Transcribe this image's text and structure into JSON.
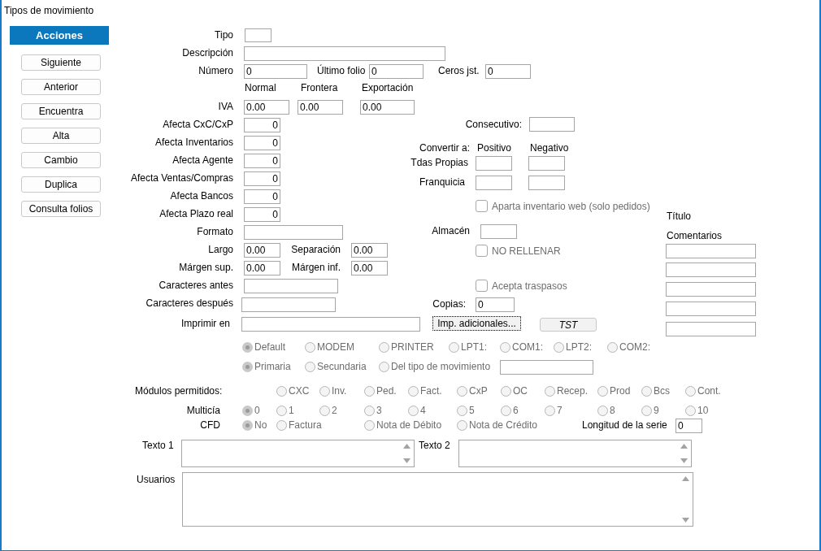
{
  "window": {
    "title": "Tipos de movimiento"
  },
  "sidebar": {
    "header": "Acciones",
    "buttons": [
      "Siguiente",
      "Anterior",
      "Encuentra",
      "Alta",
      "Cambio",
      "Duplica",
      "Consulta folios"
    ]
  },
  "form": {
    "items": [
      {
        "kind": "label",
        "text": "Tipo"
      },
      {
        "kind": "field"
      },
      {
        "kind": "label",
        "text": "Descripción"
      },
      {
        "kind": "field"
      },
      {
        "kind": "label",
        "text": "Número"
      },
      {
        "kind": "field",
        "value": "0"
      },
      {
        "kind": "label",
        "text": "Último folio"
      },
      {
        "kind": "field",
        "value": "0"
      },
      {
        "kind": "label",
        "text": "Ceros jst."
      },
      {
        "kind": "field",
        "value": "0"
      },
      {
        "kind": "label",
        "text": "Normal"
      },
      {
        "kind": "label",
        "text": "Frontera"
      },
      {
        "kind": "label",
        "text": "Exportación"
      },
      {
        "kind": "label",
        "text": "IVA"
      },
      {
        "kind": "field",
        "value": "0.00"
      },
      {
        "kind": "field",
        "value": "0.00"
      },
      {
        "kind": "field",
        "value": "0.00"
      },
      {
        "kind": "label",
        "text": "Afecta  CxC/CxP"
      },
      {
        "kind": "field",
        "value": "0"
      },
      {
        "kind": "label",
        "text": "Afecta  Inventarios"
      },
      {
        "kind": "field",
        "value": "0"
      },
      {
        "kind": "label",
        "text": "Afecta  Agente"
      },
      {
        "kind": "field",
        "value": "0"
      },
      {
        "kind": "label",
        "text": "Afecta  Ventas/Compras"
      },
      {
        "kind": "field",
        "value": "0"
      },
      {
        "kind": "label",
        "text": "Afecta  Bancos"
      },
      {
        "kind": "field",
        "value": "0"
      },
      {
        "kind": "label",
        "text": "Afecta  Plazo real"
      },
      {
        "kind": "field",
        "value": "0"
      },
      {
        "kind": "label",
        "text": "Consecutivo:"
      },
      {
        "kind": "field"
      },
      {
        "kind": "label",
        "text": "Convertir a:"
      },
      {
        "kind": "label",
        "text": "Positivo"
      },
      {
        "kind": "label",
        "text": "Negativo"
      },
      {
        "kind": "label",
        "text": "Tdas Propias"
      },
      {
        "kind": "field"
      },
      {
        "kind": "field"
      },
      {
        "kind": "label",
        "text": "Franquicia"
      },
      {
        "kind": "field"
      },
      {
        "kind": "field"
      },
      {
        "kind": "checkbox",
        "text": "Aparta inventario web (solo pedidos)",
        "checked": false,
        "disabled": true
      },
      {
        "kind": "label",
        "text": "Título"
      },
      {
        "kind": "label",
        "text": "Almacén"
      },
      {
        "kind": "field"
      },
      {
        "kind": "label",
        "text": "Comentarios"
      },
      {
        "kind": "checkbox",
        "text": "NO RELLENAR",
        "checked": false,
        "disabled": true
      },
      {
        "kind": "field"
      },
      {
        "kind": "field"
      },
      {
        "kind": "field"
      },
      {
        "kind": "field"
      },
      {
        "kind": "field"
      },
      {
        "kind": "label",
        "text": "Formato"
      },
      {
        "kind": "field"
      },
      {
        "kind": "label",
        "text": "Largo"
      },
      {
        "kind": "field",
        "value": "0.00"
      },
      {
        "kind": "label",
        "text": "Separación"
      },
      {
        "kind": "field",
        "value": "0.00"
      },
      {
        "kind": "label",
        "text": "Márgen sup."
      },
      {
        "kind": "field",
        "value": "0.00"
      },
      {
        "kind": "label",
        "text": "Márgen inf."
      },
      {
        "kind": "field",
        "value": "0.00"
      },
      {
        "kind": "label",
        "text": "Caracteres antes"
      },
      {
        "kind": "field"
      },
      {
        "kind": "label",
        "text": "Caracteres después"
      },
      {
        "kind": "field"
      },
      {
        "kind": "checkbox",
        "text": "Acepta traspasos",
        "checked": false,
        "disabled": true
      },
      {
        "kind": "label",
        "text": "Copias:"
      },
      {
        "kind": "field",
        "value": "0"
      },
      {
        "kind": "label",
        "text": "Imprimir en"
      },
      {
        "kind": "field"
      },
      {
        "kind": "button",
        "text": "Imp. adicionales...",
        "focused": true
      },
      {
        "kind": "button",
        "text": "TST",
        "focused": false
      },
      {
        "kind": "radio",
        "text": "Default",
        "selected": true,
        "disabled": true
      },
      {
        "kind": "radio",
        "text": "MODEM",
        "selected": false,
        "disabled": true
      },
      {
        "kind": "radio",
        "text": "PRINTER",
        "selected": false,
        "disabled": true
      },
      {
        "kind": "radio",
        "text": "LPT1:",
        "selected": false,
        "disabled": true
      },
      {
        "kind": "radio",
        "text": "COM1:",
        "selected": false,
        "disabled": true
      },
      {
        "kind": "radio",
        "text": "LPT2:",
        "selected": false,
        "disabled": true
      },
      {
        "kind": "radio",
        "text": "COM2:",
        "selected": false,
        "disabled": true
      },
      {
        "kind": "radio",
        "text": "Primaria",
        "selected": true,
        "disabled": true
      },
      {
        "kind": "radio",
        "text": "Secundaria",
        "selected": false,
        "disabled": true
      },
      {
        "kind": "radio",
        "text": "Del tipo de movimiento",
        "selected": false,
        "disabled": true
      },
      {
        "kind": "field"
      },
      {
        "kind": "label",
        "text": "Módulos permitidos:"
      },
      {
        "kind": "radio",
        "text": "CXC",
        "selected": false,
        "disabled": true
      },
      {
        "kind": "radio",
        "text": "Inv.",
        "selected": false,
        "disabled": true
      },
      {
        "kind": "radio",
        "text": "Ped.",
        "selected": false,
        "disabled": true
      },
      {
        "kind": "radio",
        "text": "Fact.",
        "selected": false,
        "disabled": true
      },
      {
        "kind": "radio",
        "text": "CxP",
        "selected": false,
        "disabled": true
      },
      {
        "kind": "radio",
        "text": "OC",
        "selected": false,
        "disabled": true
      },
      {
        "kind": "radio",
        "text": "Recep.",
        "selected": false,
        "disabled": true
      },
      {
        "kind": "radio",
        "text": "Prod",
        "selected": false,
        "disabled": true
      },
      {
        "kind": "radio",
        "text": "Bcs",
        "selected": false,
        "disabled": true
      },
      {
        "kind": "radio",
        "text": "Cont.",
        "selected": false,
        "disabled": true
      },
      {
        "kind": "label",
        "text": "Multicía"
      },
      {
        "kind": "radio",
        "text": "0",
        "selected": true,
        "disabled": true
      },
      {
        "kind": "radio",
        "text": "1",
        "selected": false,
        "disabled": true
      },
      {
        "kind": "radio",
        "text": "2",
        "selected": false,
        "disabled": true
      },
      {
        "kind": "radio",
        "text": "3",
        "selected": false,
        "disabled": true
      },
      {
        "kind": "radio",
        "text": "4",
        "selected": false,
        "disabled": true
      },
      {
        "kind": "radio",
        "text": "5",
        "selected": false,
        "disabled": true
      },
      {
        "kind": "radio",
        "text": "6",
        "selected": false,
        "disabled": true
      },
      {
        "kind": "radio",
        "text": "7",
        "selected": false,
        "disabled": true
      },
      {
        "kind": "radio",
        "text": "8",
        "selected": false,
        "disabled": true
      },
      {
        "kind": "radio",
        "text": "9",
        "selected": false,
        "disabled": true
      },
      {
        "kind": "radio",
        "text": "10",
        "selected": false,
        "disabled": true
      },
      {
        "kind": "label",
        "text": "CFD"
      },
      {
        "kind": "radio",
        "text": "No",
        "selected": true,
        "disabled": true
      },
      {
        "kind": "radio",
        "text": "Factura",
        "selected": false,
        "disabled": true
      },
      {
        "kind": "radio",
        "text": "Nota de Débito",
        "selected": false,
        "disabled": true
      },
      {
        "kind": "radio",
        "text": "Nota de Crédito",
        "selected": false,
        "disabled": true
      },
      {
        "kind": "label",
        "text": "Longitud de la serie"
      },
      {
        "kind": "field",
        "value": "0"
      },
      {
        "kind": "label",
        "text": "Texto 1"
      },
      {
        "kind": "textarea"
      },
      {
        "kind": "label",
        "text": "Texto 2"
      },
      {
        "kind": "textarea"
      },
      {
        "kind": "label",
        "text": "Usuarios"
      },
      {
        "kind": "textarea"
      }
    ]
  }
}
